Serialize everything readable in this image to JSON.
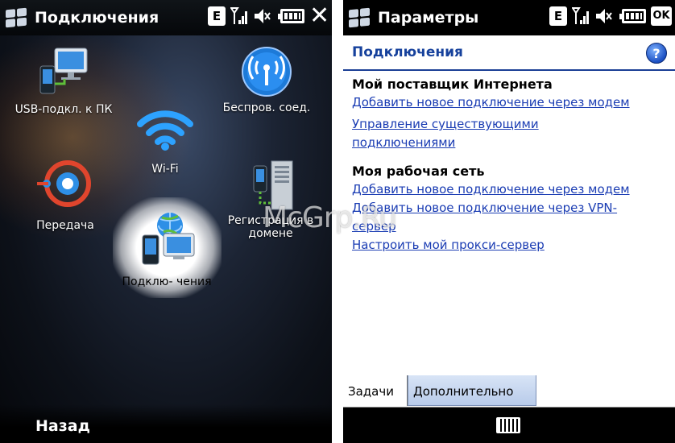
{
  "left": {
    "title": "Подключения",
    "status": {
      "e_label": "E"
    },
    "items": [
      {
        "label": "USB-подкл. к ПК"
      },
      {
        "label": "Беспров. соед."
      },
      {
        "label": "Wi-Fi"
      },
      {
        "label": "Передача"
      },
      {
        "label": "Регистрация в"
      },
      {
        "label": "домене"
      },
      {
        "label": "Подклю- чения"
      }
    ],
    "softkey": "Назад"
  },
  "right": {
    "title": "Параметры",
    "status": {
      "e_label": "E",
      "ok_label": "OK"
    },
    "header": "Подключения",
    "help_label": "?",
    "section1": {
      "title": "Мой поставщик Интернета",
      "links": [
        "Добавить новое подключение через модем",
        "Управление существующими",
        "подключениями"
      ]
    },
    "section2": {
      "title": "Моя рабочая сеть",
      "links": [
        "Добавить новое подключение через модем",
        "Добавить новое подключение через VPN-",
        "сервер",
        "Настроить мой прокси-сервер"
      ]
    },
    "tabs": [
      "Задачи",
      "Дополнительно"
    ]
  },
  "watermark": "McGrp.Ru",
  "colors": {
    "link": "#1a3cb3",
    "header_title": "#16419c",
    "tab_inactive": "#c4d4ee"
  }
}
